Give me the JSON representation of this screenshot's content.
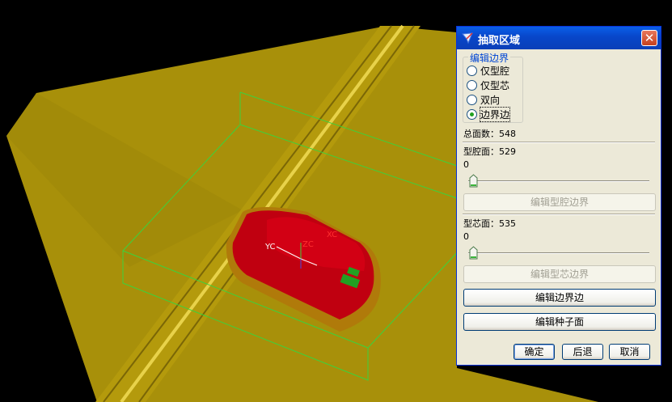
{
  "viewport": {
    "axis_labels": {
      "yc": "YC",
      "zc": "ZC",
      "xc": "XC"
    },
    "colors": {
      "background": "#000000",
      "surface": "#a8900a",
      "part": "#c00010",
      "wireframe": "#3cd23c"
    }
  },
  "dialog": {
    "title": "抽取区域",
    "title_icon": "nx-app-icon",
    "close_icon": "close-icon",
    "close_glyph": "✕",
    "group_label": "编辑边界",
    "radio_options": [
      {
        "label": "仅型腔",
        "checked": false
      },
      {
        "label": "仅型芯",
        "checked": false
      },
      {
        "label": "双向",
        "checked": false
      },
      {
        "label": "边界边",
        "checked": true
      }
    ],
    "total_faces": "总面数：548",
    "cavity_faces": "型腔面：529",
    "cavity_slider_value": "0",
    "edit_cavity_button": "编辑型腔边界",
    "core_faces": "型芯面：535",
    "core_slider_value": "0",
    "edit_core_button": "编辑型芯边界",
    "edit_boundary_button": "编辑边界边",
    "edit_seed_button": "编辑种子面",
    "ok_button": "确定",
    "back_button": "后退",
    "cancel_button": "取消"
  }
}
